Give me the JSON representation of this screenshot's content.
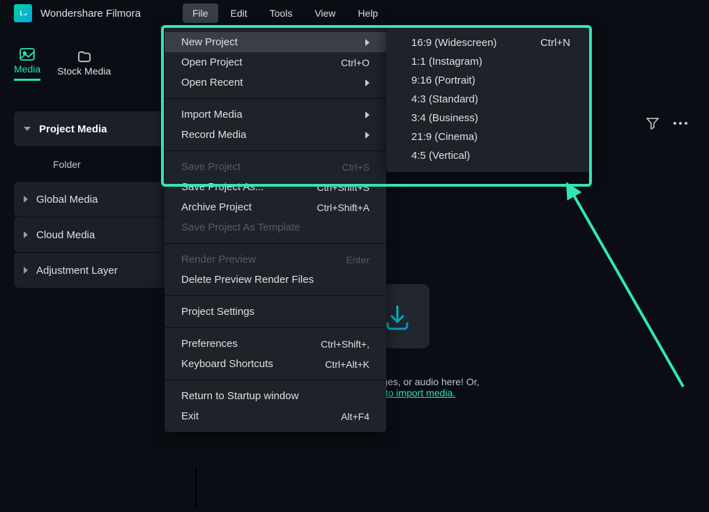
{
  "app_title": "Wondershare Filmora",
  "menubar": [
    "File",
    "Edit",
    "Tools",
    "View",
    "Help"
  ],
  "active_menu": "File",
  "tabs": [
    {
      "label": "Media",
      "active": true
    },
    {
      "label": "Stock Media",
      "active": false
    }
  ],
  "sidebar": {
    "project_media": "Project Media",
    "folder": "Folder",
    "global": "Global Media",
    "cloud": "Cloud Media",
    "adjust": "Adjustment Layer"
  },
  "file_menu": {
    "groups": [
      [
        {
          "label": "New Project",
          "caret": true,
          "highlighted": true
        },
        {
          "label": "Open Project",
          "shortcut": "Ctrl+O"
        },
        {
          "label": "Open Recent",
          "caret": true
        }
      ],
      [
        {
          "label": "Import Media",
          "caret": true
        },
        {
          "label": "Record Media",
          "caret": true
        }
      ],
      [
        {
          "label": "Save Project",
          "shortcut": "Ctrl+S",
          "disabled": true
        },
        {
          "label": "Save Project As...",
          "shortcut": "Ctrl+Shift+S"
        },
        {
          "label": "Archive Project",
          "shortcut": "Ctrl+Shift+A"
        },
        {
          "label": "Save Project As Template",
          "disabled": true
        }
      ],
      [
        {
          "label": "Render Preview",
          "shortcut": "Enter",
          "disabled": true
        },
        {
          "label": "Delete Preview Render Files"
        }
      ],
      [
        {
          "label": "Project Settings"
        }
      ],
      [
        {
          "label": "Preferences",
          "shortcut": "Ctrl+Shift+,"
        },
        {
          "label": "Keyboard Shortcuts",
          "shortcut": "Ctrl+Alt+K"
        }
      ],
      [
        {
          "label": "Return to Startup window"
        },
        {
          "label": "Exit",
          "shortcut": "Alt+F4"
        }
      ]
    ]
  },
  "new_project_submenu": [
    {
      "label": "16:9 (Widescreen)",
      "shortcut": "Ctrl+N"
    },
    {
      "label": "1:1 (Instagram)"
    },
    {
      "label": "9:16 (Portrait)"
    },
    {
      "label": "4:3 (Standard)"
    },
    {
      "label": "3:4 (Business)"
    },
    {
      "label": "21:9 (Cinema)"
    },
    {
      "label": "4:5 (Vertical)"
    }
  ],
  "center": {
    "drop_text": "video clips, images, or audio here! Or,",
    "link_text": "Click here to import media."
  }
}
